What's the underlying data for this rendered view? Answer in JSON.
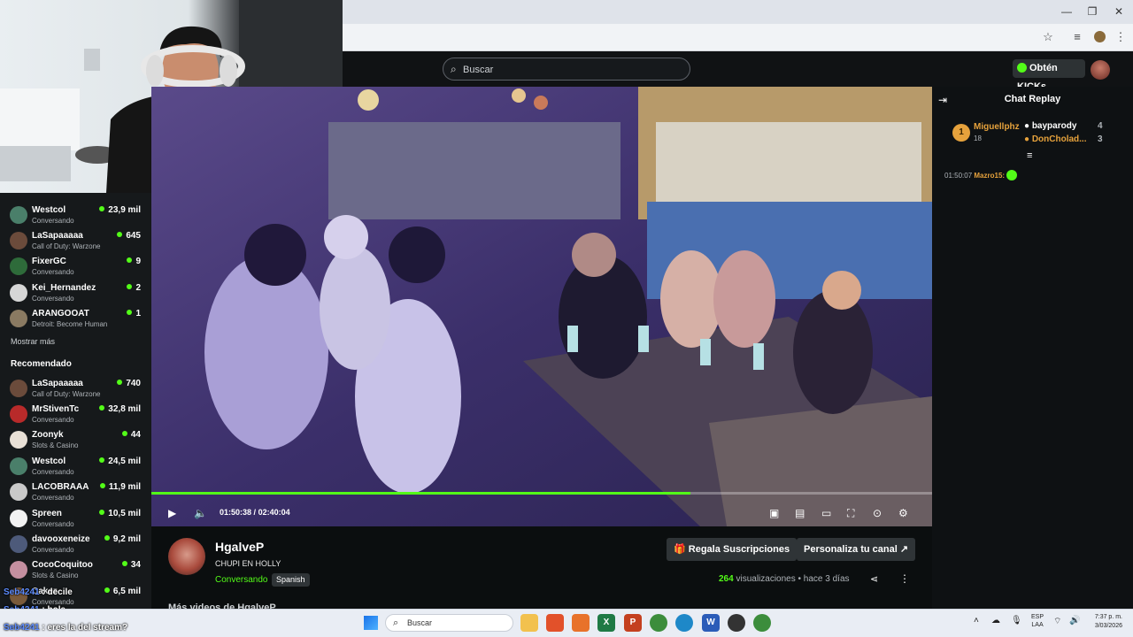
{
  "browser": {
    "controls": [
      "—",
      "❐",
      "✕"
    ]
  },
  "header": {
    "search_placeholder": "Buscar",
    "kicks_label": "Obtén KICKs"
  },
  "sidebar": {
    "following": [
      {
        "name": "Westcol",
        "category": "Conversando",
        "viewers": "23,9 mil",
        "color": "#4a7f6a"
      },
      {
        "name": "LaSapaaaaa",
        "category": "Call of Duty: Warzone",
        "viewers": "645",
        "color": "#6b4b3b"
      },
      {
        "name": "FixerGC",
        "category": "Conversando",
        "viewers": "9",
        "color": "#2e6b3a"
      },
      {
        "name": "Kei_Hernandez",
        "category": "Conversando",
        "viewers": "2",
        "color": "#d6d6d6"
      },
      {
        "name": "ARANGOOAT",
        "category": "Detroit: Become Human",
        "viewers": "1",
        "color": "#8a7a62"
      }
    ],
    "show_more": "Mostrar más",
    "recommended_heading": "Recomendado",
    "recommended": [
      {
        "name": "LaSapaaaaa",
        "category": "Call of Duty: Warzone",
        "viewers": "740",
        "color": "#6b4b3b"
      },
      {
        "name": "MrStivenTc",
        "category": "Conversando",
        "viewers": "32,8 mil",
        "color": "#b82a2a"
      },
      {
        "name": "Zoonyk",
        "category": "Slots & Casino",
        "viewers": "44",
        "color": "#e8e0d6"
      },
      {
        "name": "Westcol",
        "category": "Conversando",
        "viewers": "24,5 mil",
        "color": "#4a7f6a"
      },
      {
        "name": "LACOBRAAA",
        "category": "Conversando",
        "viewers": "11,9 mil",
        "color": "#c9c9c9"
      },
      {
        "name": "Spreen",
        "category": "Conversando",
        "viewers": "10,5 mil",
        "color": "#f2f2f2"
      },
      {
        "name": "davooxeneize",
        "category": "Conversando",
        "viewers": "9,2 mil",
        "color": "#4d5a7a"
      },
      {
        "name": "CocoCoquitoo",
        "category": "Slots & Casino",
        "viewers": "34",
        "color": "#c48fa0"
      },
      {
        "name": "Cakez",
        "category": "Conversando",
        "viewers": "6,5 mil",
        "color": "#7a5a3a"
      }
    ]
  },
  "player": {
    "time_current": "01:50:38",
    "time_total": "02:40:04",
    "time_separator": "/",
    "progress_fraction": 0.69
  },
  "channel": {
    "name": "HgalveP",
    "title": "CHUPI EN HOLLY",
    "category": "Conversando",
    "language": "Spanish",
    "gift_button": "Regala Suscripciones",
    "customize_button": "Personaliza tu canal",
    "views_count": "264",
    "views_label": "visualizaciones",
    "posted": "hace 3 días",
    "more_videos": "Más videos de HgalveP"
  },
  "chat": {
    "title": "Chat Replay",
    "leaderboard": [
      {
        "rank": "1",
        "name": "Miguellphz",
        "count": "18"
      },
      {
        "name": "bayparody",
        "count": "4"
      },
      {
        "name": "DonCholad...",
        "count": "3"
      }
    ],
    "messages": [
      {
        "time": "01:50:07",
        "user": "Mazro15:"
      }
    ]
  },
  "overlay_chat": [
    {
      "user": "Seb4241",
      "text": ": decile"
    },
    {
      "user": "Seb4241",
      "text": ": hola"
    },
    {
      "user": "Seb4241",
      "text": ": eres la del stream?"
    }
  ],
  "taskbar": {
    "search_placeholder": "Buscar",
    "lang_top": "ESP",
    "lang_bottom": "LAA",
    "time": "7:37 p. m.",
    "date": "3/03/2026"
  },
  "colors": {
    "accent": "#53fc18",
    "background": "#0b0e0f"
  }
}
